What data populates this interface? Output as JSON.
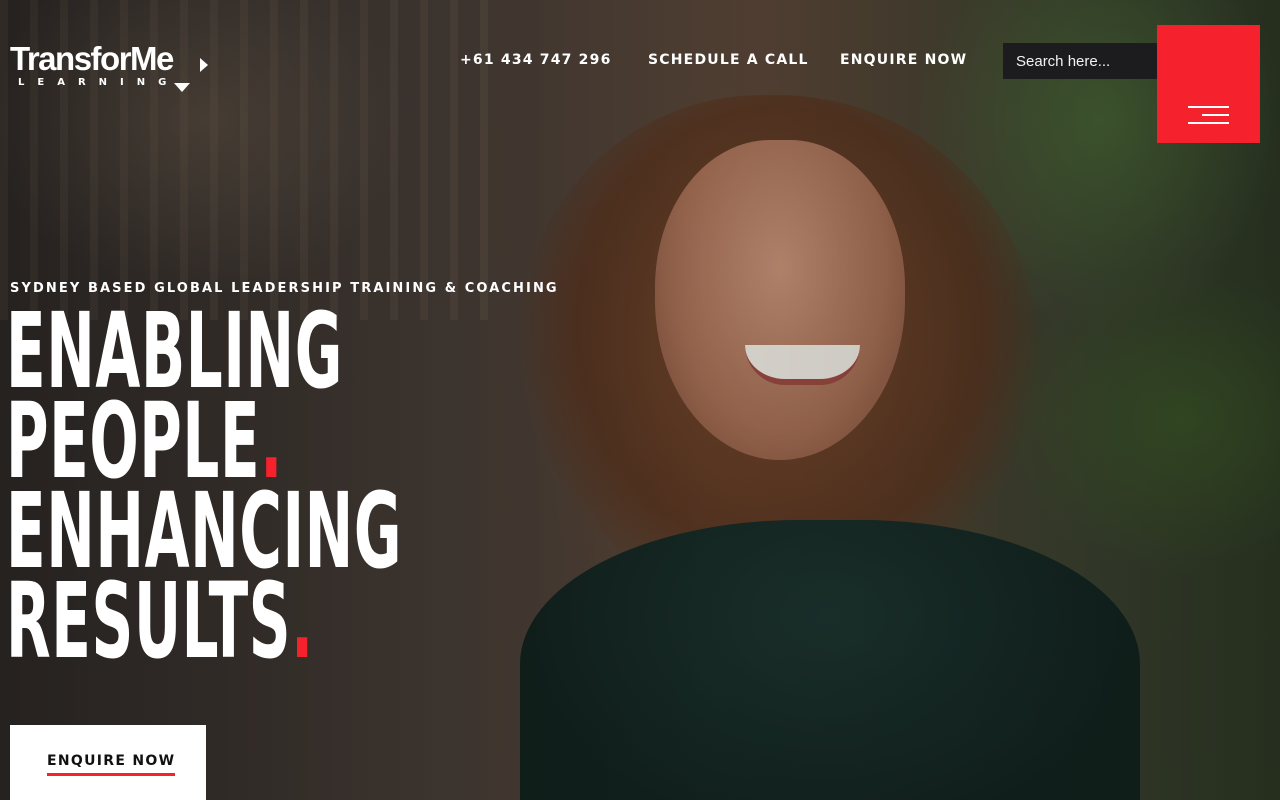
{
  "header": {
    "logo": {
      "wordmark": "TransforMe",
      "sub": "LEARNING"
    },
    "nav": {
      "phone": "+61 434 747 296",
      "schedule": "SCHEDULE A CALL",
      "enquire": "ENQUIRE NOW"
    },
    "search": {
      "placeholder": "Search here..."
    },
    "menu_icon": "hamburger-menu-icon"
  },
  "hero": {
    "tagline": "SYDNEY BASED GLOBAL LEADERSHIP TRAINING & COACHING",
    "headline": {
      "line1": "ENABLING",
      "line2": "PEOPLE",
      "line3": "ENHANCING",
      "line4": "RESULTS",
      "accent_dot": "."
    },
    "cta": "ENQUIRE NOW"
  },
  "colors": {
    "accent": "#f5222d",
    "search_bg": "#1c1c1e",
    "text": "#ffffff",
    "cta_bg": "#ffffff"
  }
}
